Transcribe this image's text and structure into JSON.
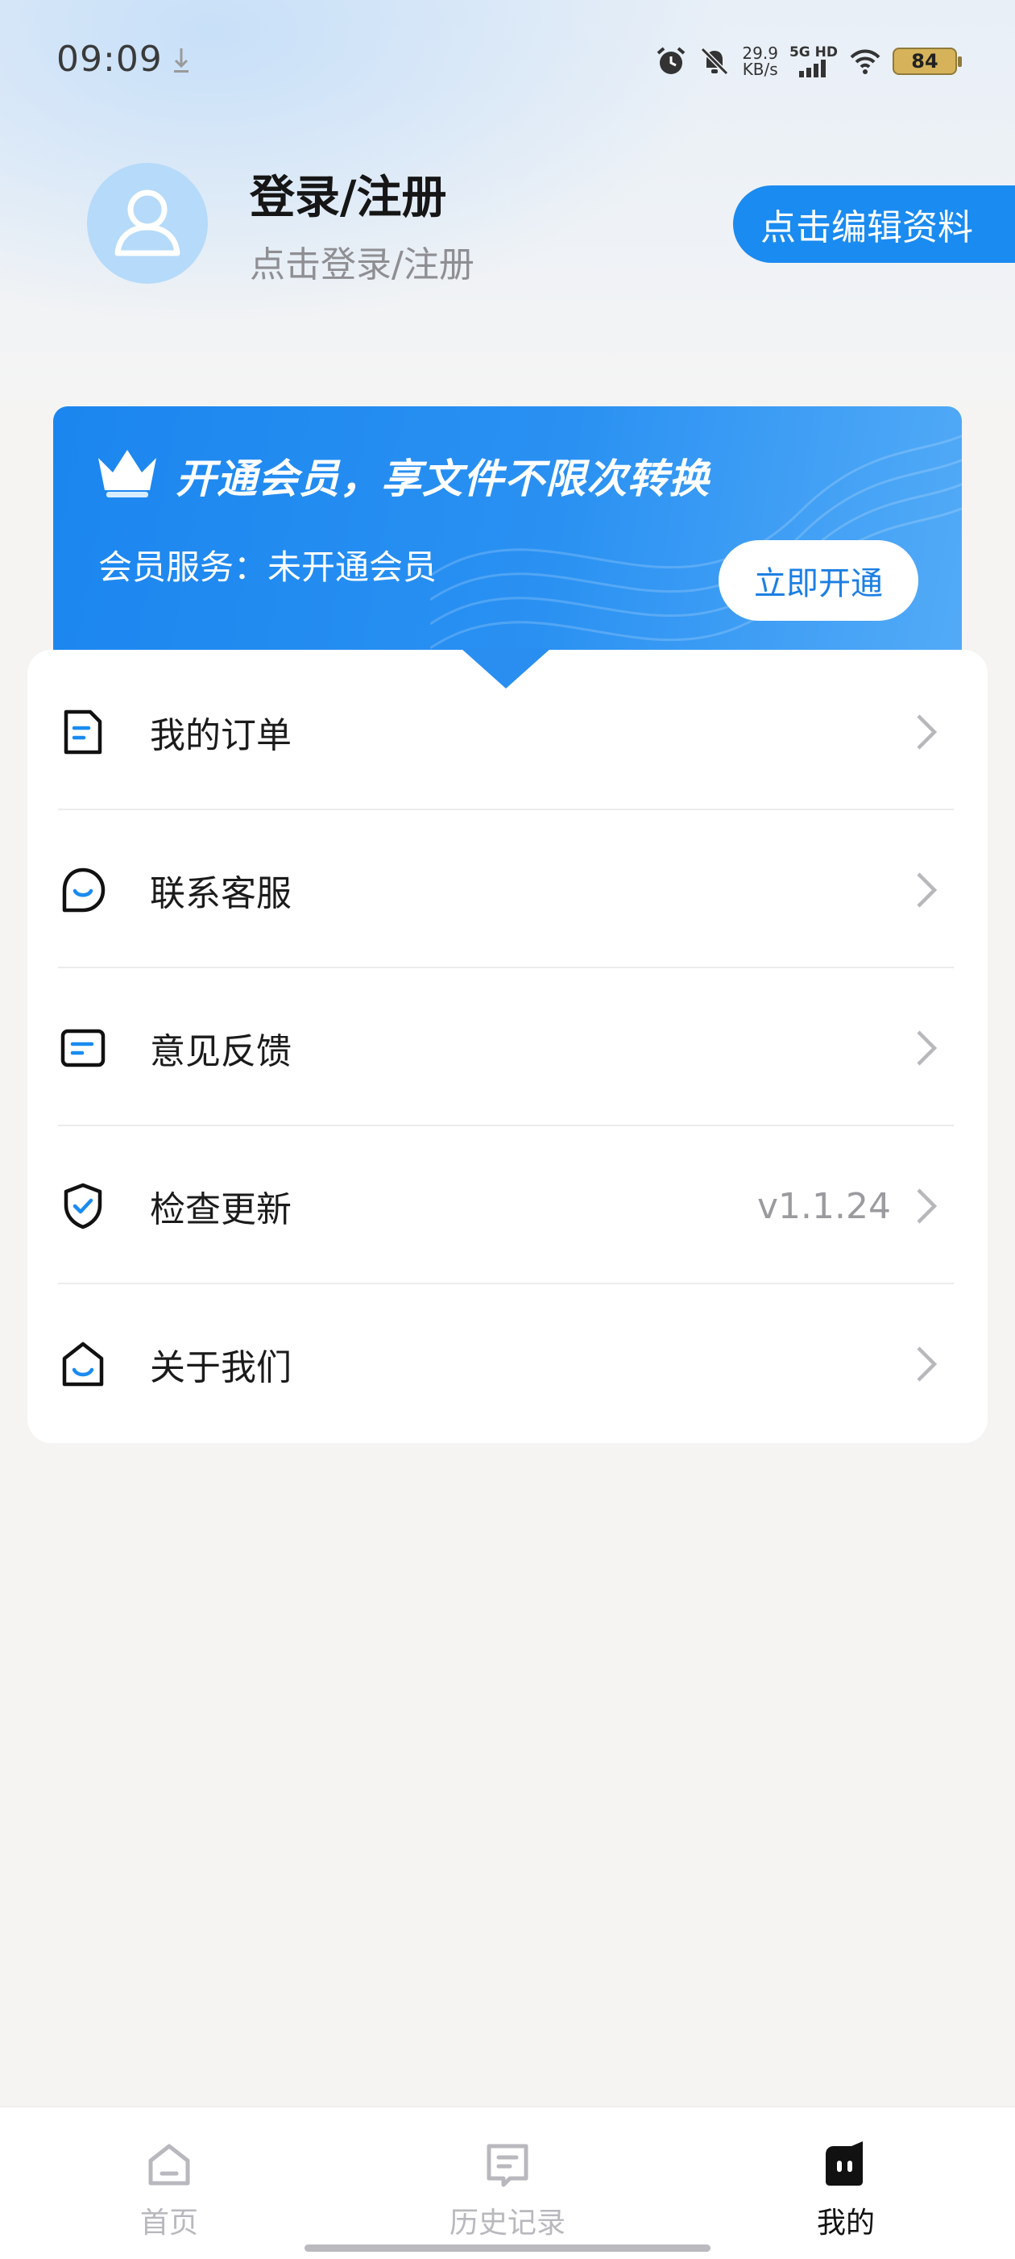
{
  "status_bar": {
    "time": "09:09",
    "net_speed_value": "29.9",
    "net_speed_unit": "KB/s",
    "network_tag": "5G HD",
    "battery": "84",
    "icons": [
      "download-icon",
      "alarm-icon",
      "mute-icon",
      "signal-icon",
      "wifi-icon",
      "battery-icon"
    ]
  },
  "profile": {
    "title": "登录/注册",
    "subtitle": "点击登录/注册",
    "edit_button": "点击编辑资料"
  },
  "vip": {
    "title": "开通会员，享文件不限次转换",
    "status": "会员服务：未开通会员",
    "open_button": "立即开通",
    "accent": "#1a8bf0"
  },
  "menu": {
    "items": [
      {
        "label": "我的订单",
        "icon": "order-icon"
      },
      {
        "label": "联系客服",
        "icon": "customer-service-icon"
      },
      {
        "label": "意见反馈",
        "icon": "feedback-icon"
      },
      {
        "label": "检查更新",
        "icon": "shield-check-icon",
        "value": "v1.1.24"
      },
      {
        "label": "关于我们",
        "icon": "about-icon"
      }
    ]
  },
  "bottom_nav": {
    "items": [
      {
        "label": "首页",
        "icon": "home-icon",
        "active": false
      },
      {
        "label": "历史记录",
        "icon": "history-icon",
        "active": false
      },
      {
        "label": "我的",
        "icon": "profile-icon",
        "active": true
      }
    ]
  }
}
